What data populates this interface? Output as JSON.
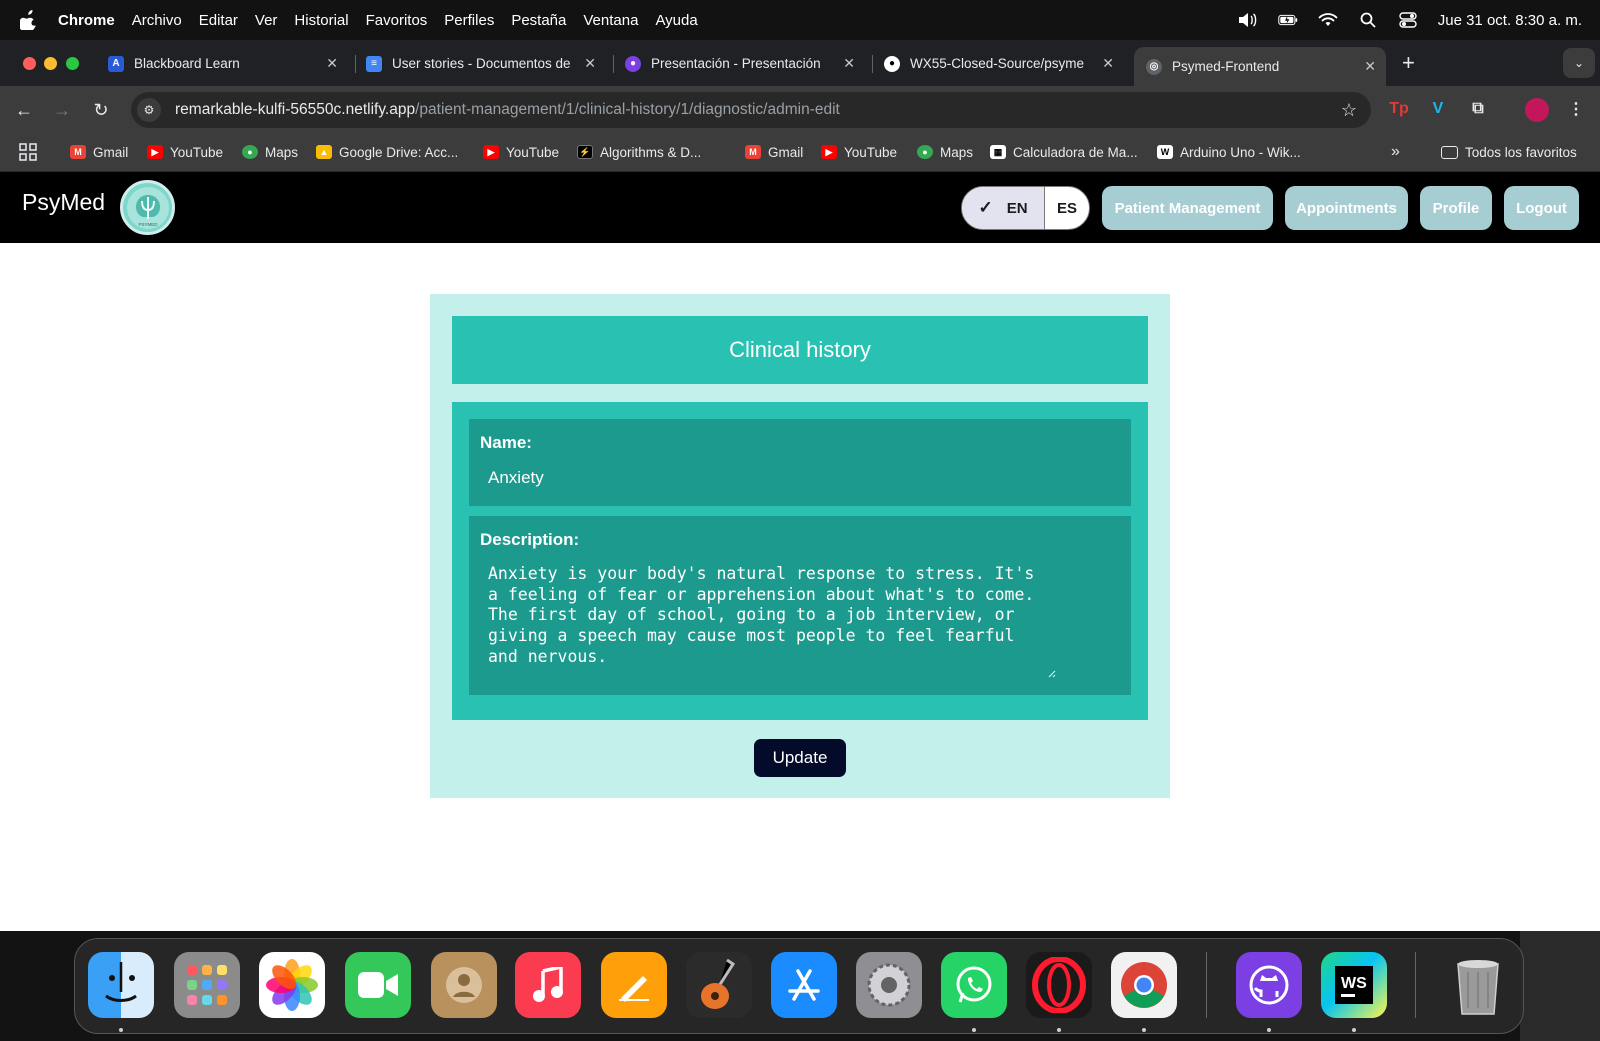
{
  "menubar": {
    "app_name": "Chrome",
    "menus": [
      "Archivo",
      "Editar",
      "Ver",
      "Historial",
      "Favoritos",
      "Perfiles",
      "Pestaña",
      "Ventana",
      "Ayuda"
    ],
    "datetime": "Jue 31 oct. 8:30 a. m."
  },
  "tabs": [
    {
      "title": "Blackboard Learn",
      "icon": "blackboard-icon",
      "active": false
    },
    {
      "title": "User stories - Documentos de",
      "icon": "google-docs-icon",
      "active": false
    },
    {
      "title": "Presentación - Presentación",
      "icon": "presentation-icon",
      "active": false
    },
    {
      "title": "WX55-Closed-Source/psyme",
      "icon": "github-icon",
      "active": false
    },
    {
      "title": "Psymed-Frontend",
      "icon": "netlify-site-icon",
      "active": true
    }
  ],
  "address_bar": {
    "host": "remarkable-kulfi-56550c.netlify.app",
    "path": "/patient-management/1/clinical-history/1/diagnostic/admin-edit"
  },
  "bookmarks": [
    {
      "label": "Gmail",
      "icon": "gmail-icon"
    },
    {
      "label": "YouTube",
      "icon": "youtube-icon"
    },
    {
      "label": "Maps",
      "icon": "maps-icon"
    },
    {
      "label": "Google Drive: Acc...",
      "icon": "google-drive-icon"
    },
    {
      "label": "YouTube",
      "icon": "youtube-icon"
    },
    {
      "label": "Algorithms & D...",
      "icon": "algorithms-icon"
    },
    {
      "label": "Gmail",
      "icon": "gmail-icon"
    },
    {
      "label": "YouTube",
      "icon": "youtube-icon"
    },
    {
      "label": "Maps",
      "icon": "maps-icon"
    },
    {
      "label": "Calculadora de Ma...",
      "icon": "calculator-icon"
    },
    {
      "label": "Arduino Uno - Wik...",
      "icon": "wikipedia-icon"
    }
  ],
  "bookmarks_all_label": "Todos los favoritos",
  "app": {
    "brand": "PsyMed",
    "logo_text": "PSYMED",
    "lang": {
      "en": "EN",
      "es": "ES",
      "selected": "EN"
    },
    "nav": {
      "patient_management": "Patient Management",
      "appointments": "Appointments",
      "profile": "Profile",
      "logout": "Logout"
    },
    "colors": {
      "card_bg": "#c3f0eb",
      "teal": "#28c1b2",
      "field_bg": "#1c9a8e",
      "nav_pill": "#a6cdd2",
      "update_btn": "#030a2a"
    }
  },
  "clinical_history": {
    "title": "Clinical history",
    "name_label": "Name:",
    "name_value": "Anxiety",
    "description_label": "Description:",
    "description_value": "Anxiety is your body's natural response to stress. It's a feeling of fear or apprehension about what's to come. The first day of school, going to a job interview, or giving a speech may cause most people to feel fearful and nervous.",
    "update_label": "Update"
  },
  "dock": [
    "finder-icon",
    "launchpad-icon",
    "photos-icon",
    "facetime-icon",
    "contacts-icon",
    "music-icon",
    "pages-icon",
    "garageband-icon",
    "app-store-icon",
    "system-settings-icon",
    "whatsapp-icon",
    "opera-icon",
    "chrome-icon",
    "github-desktop-icon",
    "webstorm-icon",
    "trash-icon"
  ]
}
